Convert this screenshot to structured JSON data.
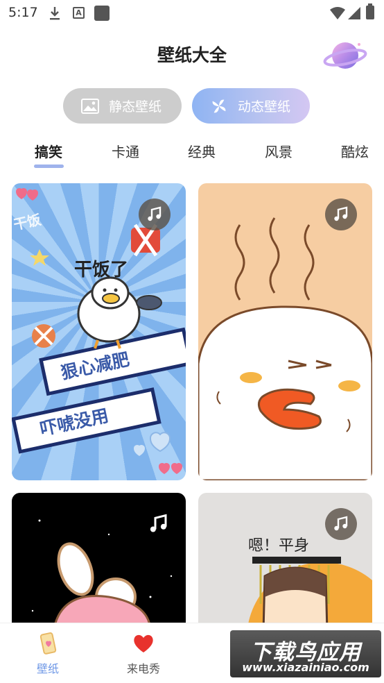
{
  "status_bar": {
    "time": "5:17",
    "icons": [
      "download-icon",
      "a-icon",
      "square-icon",
      "wifi-icon",
      "signal-icon",
      "battery-icon"
    ]
  },
  "header": {
    "title": "壁纸大全",
    "icon": "planet-icon"
  },
  "mode_toggle": {
    "static_label": "静态壁纸",
    "dynamic_label": "动态壁纸",
    "selected": "动态壁纸"
  },
  "categories": {
    "items": [
      "搞笑",
      "卡通",
      "经典",
      "风景",
      "酷炫"
    ],
    "active": "搞笑"
  },
  "cards": [
    {
      "type": "dynamic",
      "icon": "music-note-icon",
      "texts": [
        "干饭",
        "干饭了",
        "狠心减肥",
        "吓唬没用"
      ]
    },
    {
      "type": "dynamic",
      "icon": "music-note-icon"
    },
    {
      "type": "dynamic",
      "icon": "music-note-icon"
    },
    {
      "type": "dynamic",
      "icon": "music-note-icon",
      "texts": [
        "嗯！平身"
      ]
    }
  ],
  "bottom_nav": {
    "items": [
      {
        "label": "壁纸",
        "icon": "phone-wallpaper-icon"
      },
      {
        "label": "来电秀",
        "icon": "heart-icon"
      }
    ],
    "active": "壁纸"
  },
  "watermark": {
    "title": "下载鸟应用",
    "url": "www.xiazainiao.com"
  },
  "colors": {
    "accent": "#6f98e6",
    "tab_underline": "#9fb3ec",
    "static_button": "#cdcdcd",
    "dynamic_button_start": "#8fb4f3",
    "dynamic_button_end": "#d4c7f2"
  }
}
